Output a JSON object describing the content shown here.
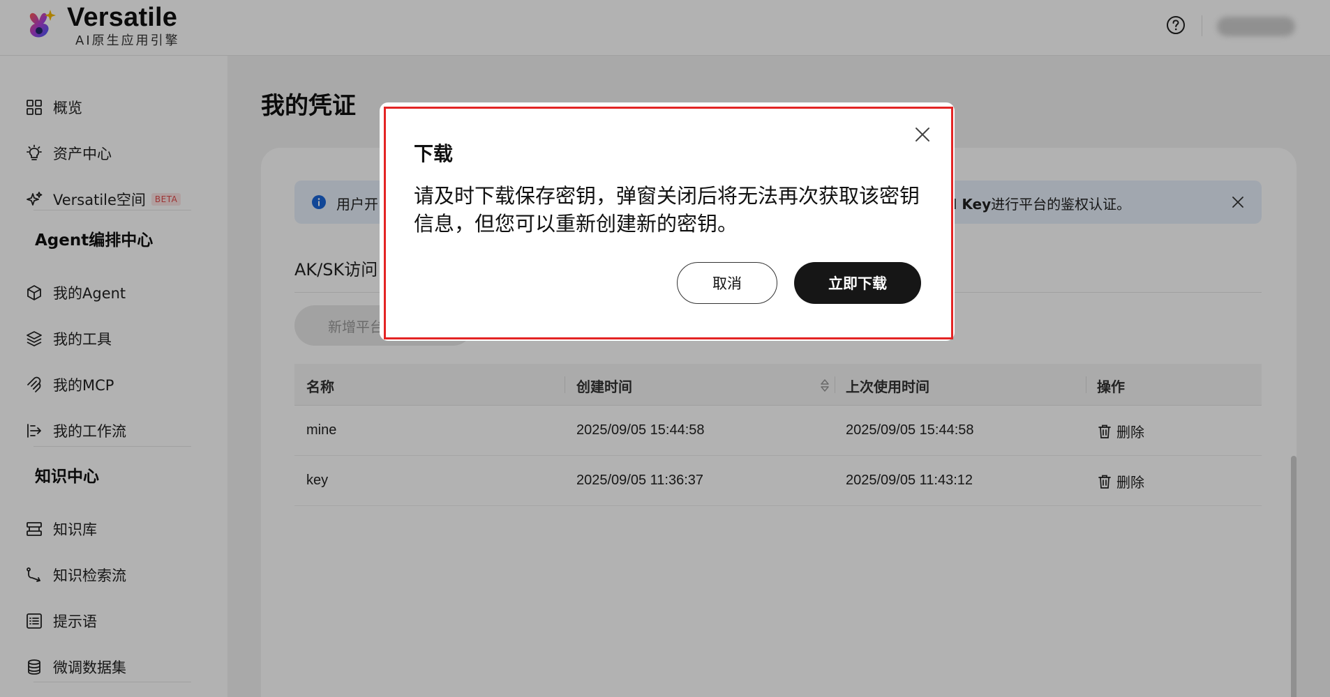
{
  "header": {
    "brand_name": "Versatile",
    "brand_subtitle": "AI原生应用引擎",
    "help_icon": "question-circle-icon"
  },
  "sidebar": {
    "items_top": [
      {
        "label": "概览",
        "icon": "grid-icon"
      },
      {
        "label": "资产中心",
        "icon": "lightbulb-icon"
      },
      {
        "label": "Versatile空间",
        "icon": "sparkle-icon",
        "badge": "BETA"
      }
    ],
    "section_agent": "Agent编排中心",
    "items_agent": [
      {
        "label": "我的Agent",
        "icon": "cube-icon"
      },
      {
        "label": "我的工具",
        "icon": "layers-icon"
      },
      {
        "label": "我的MCP",
        "icon": "mcp-icon"
      },
      {
        "label": "我的工作流",
        "icon": "workflow-icon"
      }
    ],
    "section_knowledge": "知识中心",
    "items_knowledge": [
      {
        "label": "知识库",
        "icon": "database-stack-icon"
      },
      {
        "label": "知识检索流",
        "icon": "flow-arrow-icon"
      },
      {
        "label": "提示语",
        "icon": "list-icon"
      },
      {
        "label": "微调数据集",
        "icon": "cylinder-icon"
      }
    ]
  },
  "main": {
    "page_title": "我的凭证",
    "banner": {
      "text_left": "用户开",
      "text_right_bold": "I Key",
      "text_right": "进行平台的鉴权认证。"
    },
    "section_title": "AK/SK访问",
    "add_button": "新增平台",
    "table": {
      "headers": [
        "名称",
        "创建时间",
        "上次使用时间",
        "操作"
      ],
      "rows": [
        {
          "name": "mine",
          "created": "2025/09/05 15:44:58",
          "last_used": "2025/09/05 15:44:58",
          "action": "删除"
        },
        {
          "name": "key",
          "created": "2025/09/05 11:36:37",
          "last_used": "2025/09/05 11:43:12",
          "action": "删除"
        }
      ]
    }
  },
  "modal": {
    "title": "下载",
    "body": "请及时下载保存密钥，弹窗关闭后将无法再次获取该密钥信息，但您可以重新创建新的密钥。",
    "cancel_label": "取消",
    "confirm_label": "立即下载"
  },
  "colors": {
    "highlight_border": "#e32424",
    "primary_button": "#161616",
    "banner_bg": "#e7f0fb",
    "info_blue": "#1a66d9",
    "beta_red": "#e04b4b"
  }
}
